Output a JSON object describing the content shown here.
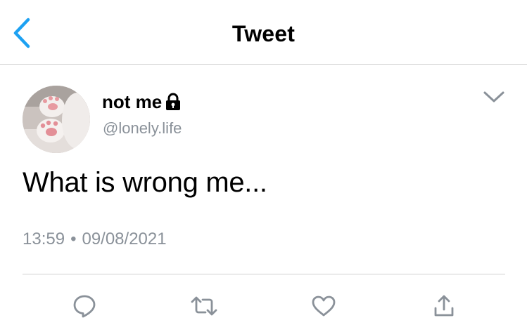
{
  "header": {
    "title": "Tweet",
    "back_icon": "chevron-left-icon"
  },
  "colors": {
    "accent": "#1da1f2",
    "secondary_text": "#8a9199",
    "divider": "#cfcfcf",
    "icon_gray": "#8a9199"
  },
  "tweet": {
    "display_name": "not me",
    "protected_icon": "lock-icon",
    "handle": "@lonely.life",
    "text": "What is wrong me...",
    "time": "13:59",
    "separator": "•",
    "date": "09/08/2021",
    "menu_icon": "chevron-down-icon"
  },
  "actions": [
    {
      "icon": "reply-icon"
    },
    {
      "icon": "retweet-icon"
    },
    {
      "icon": "like-icon"
    },
    {
      "icon": "share-icon"
    }
  ]
}
